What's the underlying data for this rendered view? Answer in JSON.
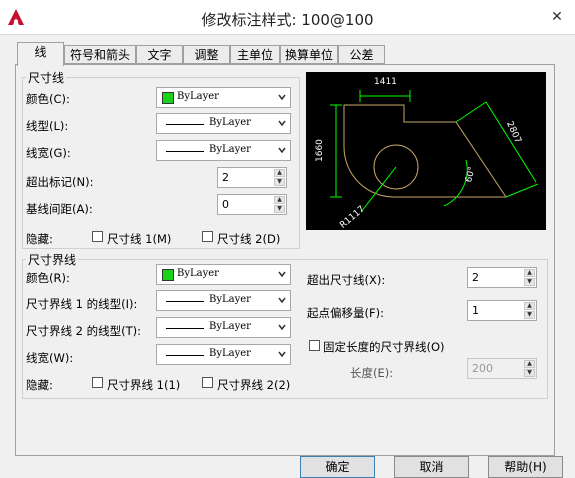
{
  "window": {
    "title": "修改标注样式: 100@100",
    "close": "✕"
  },
  "tabs": [
    "线",
    "符号和箭头",
    "文字",
    "调整",
    "主单位",
    "换算单位",
    "公差"
  ],
  "dim_lines": {
    "group_label": "尺寸线",
    "color_label": "颜色(C):",
    "color_value": "ByLayer",
    "linetype_label": "线型(L):",
    "linetype_value": "ByLayer",
    "lineweight_label": "线宽(G):",
    "lineweight_value": "ByLayer",
    "extend_label": "超出标记(N):",
    "extend_value": "2",
    "baseline_label": "基线间距(A):",
    "baseline_value": "0",
    "suppress_label": "隐藏:",
    "suppress_1": "尺寸线 1(M)",
    "suppress_2": "尺寸线 2(D)"
  },
  "ext_lines": {
    "group_label": "尺寸界线",
    "color_label": "颜色(R):",
    "color_value": "ByLayer",
    "linetype1_label": "尺寸界线 1 的线型(I):",
    "linetype1_value": "ByLayer",
    "linetype2_label": "尺寸界线 2 的线型(T):",
    "linetype2_value": "ByLayer",
    "lineweight_label": "线宽(W):",
    "lineweight_value": "ByLayer",
    "suppress_label": "隐藏:",
    "suppress_1": "尺寸界线 1(1)",
    "suppress_2": "尺寸界线 2(2)",
    "extend_label": "超出尺寸线(X):",
    "extend_value": "2",
    "offset_label": "起点偏移量(F):",
    "offset_value": "1",
    "fixed_label": "固定长度的尺寸界线(O)",
    "length_label": "长度(E):",
    "length_value": "200"
  },
  "preview": {
    "dim_top": "1411",
    "dim_left": "1660",
    "dim_right": "2807",
    "dim_angle": "60°",
    "dim_radius": "R1117"
  },
  "buttons": {
    "ok": "确定",
    "cancel": "取消",
    "help": "帮助(H)"
  },
  "colors": {
    "bylayer_swatch": "#19d219",
    "preview_bg": "#000000",
    "dim_green": "#00ff00",
    "geometry": "#c8a86a"
  }
}
